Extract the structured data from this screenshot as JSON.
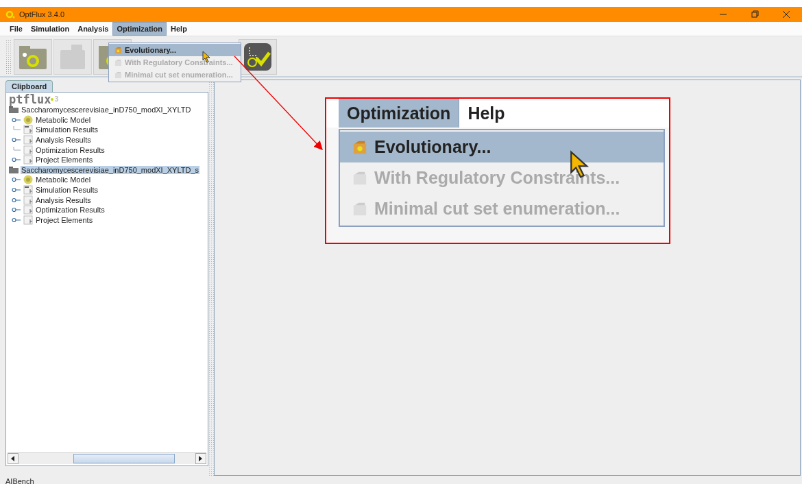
{
  "window": {
    "title": "OptFlux 3.4.0"
  },
  "menu_bar": [
    {
      "label": "File",
      "selected": false
    },
    {
      "label": "Simulation",
      "selected": false
    },
    {
      "label": "Analysis",
      "selected": false
    },
    {
      "label": "Optimization",
      "selected": true
    },
    {
      "label": "Help",
      "selected": false
    }
  ],
  "toolbar": [
    {
      "kind": "new-project",
      "disabled": false
    },
    {
      "kind": "open-project",
      "disabled": true
    },
    {
      "kind": "load-project",
      "disabled": false
    }
  ],
  "toolbar_end": {
    "kind": "validate",
    "disabled": false
  },
  "dropdown": [
    {
      "label": "Evolutionary...",
      "selected": true,
      "disabled": false
    },
    {
      "label": "With Regulatory Constraints...",
      "selected": false,
      "disabled": true
    },
    {
      "label": "Minimal cut set enumeration...",
      "selected": false,
      "disabled": true
    }
  ],
  "clipboard": {
    "tab": "Clipboard",
    "logo": "ptflux",
    "logo_version": "3",
    "tree": [
      {
        "label": "Saccharomycescerevisiae_inD750_modXI_XYLTD",
        "selected": false,
        "children": [
          {
            "label": "Metabolic Model",
            "kind": "model",
            "expandable": true
          },
          {
            "label": "Simulation Results",
            "kind": "simulation",
            "expandable": false
          },
          {
            "label": "Analysis Results",
            "kind": "results",
            "expandable": true
          },
          {
            "label": "Optimization Results",
            "kind": "results",
            "expandable": false
          },
          {
            "label": "Project Elements",
            "kind": "results",
            "expandable": true
          }
        ]
      },
      {
        "label": "Saccharomycescerevisiae_inD750_modXI_XYLTD_s",
        "selected": true,
        "children": [
          {
            "label": "Metabolic Model",
            "kind": "model",
            "expandable": true
          },
          {
            "label": "Simulation Results",
            "kind": "simulation",
            "expandable": true
          },
          {
            "label": "Analysis Results",
            "kind": "results",
            "expandable": true
          },
          {
            "label": "Optimization Results",
            "kind": "results",
            "expandable": true
          },
          {
            "label": "Project Elements",
            "kind": "results",
            "expandable": true
          }
        ]
      }
    ]
  },
  "status_bar": "AIBench",
  "callout": {
    "menu_bar": [
      {
        "label": "Optimization",
        "selected": true
      },
      {
        "label": "Help",
        "selected": false
      }
    ],
    "items": [
      {
        "label": "Evolutionary...",
        "selected": true,
        "disabled": false
      },
      {
        "label": "With Regulatory Constraints...",
        "selected": false,
        "disabled": true
      },
      {
        "label": "Minimal cut set enumeration...",
        "selected": false,
        "disabled": true
      }
    ]
  }
}
